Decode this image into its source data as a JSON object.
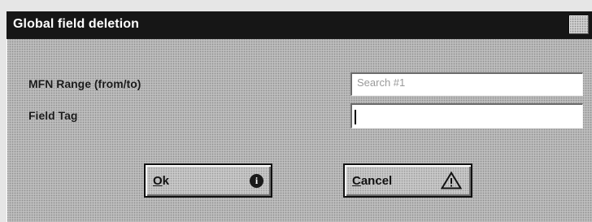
{
  "dialog": {
    "title": "Global field deletion"
  },
  "form": {
    "mfn_label": "MFN Range (from/to)",
    "mfn_value": "Search #1",
    "tag_label": "Field Tag",
    "tag_value": ""
  },
  "buttons": {
    "ok_label_underlined": "O",
    "ok_label_rest": "k",
    "ok_icon": "info-icon",
    "ok_icon_glyph": "i",
    "cancel_label_underlined": "C",
    "cancel_label_rest": "ancel",
    "cancel_icon": "warning-icon"
  }
}
